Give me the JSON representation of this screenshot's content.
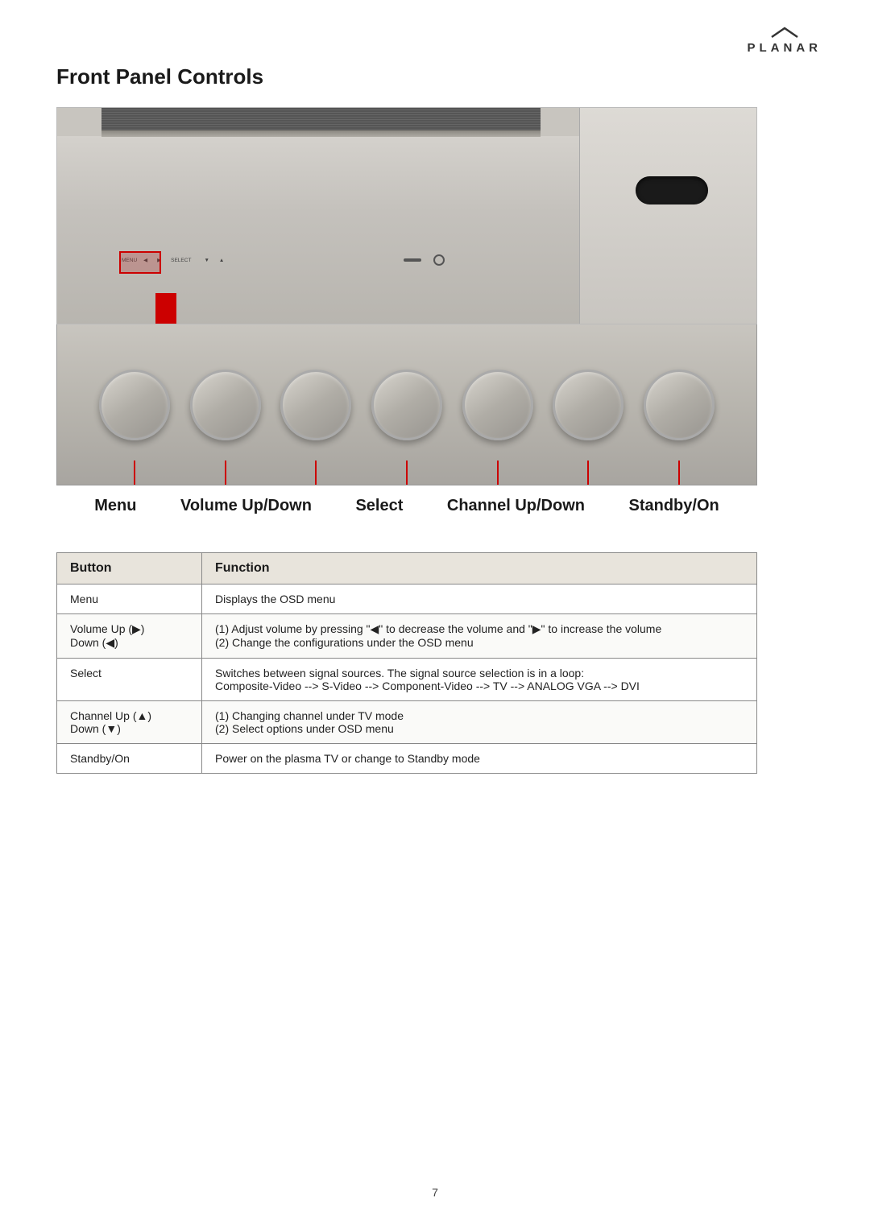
{
  "logo": {
    "chevron": "⌒",
    "text": "PLANAR"
  },
  "page": {
    "title": "Front Panel Controls",
    "number": "7"
  },
  "button_labels": {
    "menu": "Menu",
    "volume": "Volume Up/Down",
    "select": "Select",
    "channel": "Channel Up/Down",
    "standby": "Standby/On"
  },
  "table": {
    "header_button": "Button",
    "header_function": "Function",
    "rows": [
      {
        "button": "Menu",
        "function": "Displays the OSD menu"
      },
      {
        "button": "Volume Up (▶)\nDown (◀)",
        "function": "(1) Adjust volume by pressing \"◀\" to decrease the volume and \"▶\" to increase the volume\n(2) Change the configurations under the OSD menu"
      },
      {
        "button": "Select",
        "function": "Switches between signal sources. The signal source selection is in a loop:\nComposite-Video --> S-Video --> Component-Video --> TV --> ANALOG VGA --> DVI"
      },
      {
        "button": "Channel Up (▲)\nDown (▼)",
        "function": "(1) Changing channel under TV mode\n(2) Select options under OSD menu"
      },
      {
        "button": "Standby/On",
        "function": "Power on the plasma TV or change to Standby mode"
      }
    ]
  }
}
